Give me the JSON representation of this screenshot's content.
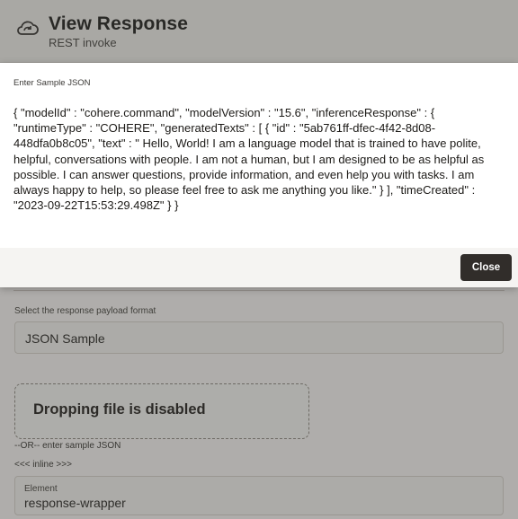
{
  "header": {
    "title": "View Response",
    "subtitle": "REST invoke",
    "icon": "cloud-refresh-icon"
  },
  "dialog": {
    "label": "Enter Sample JSON",
    "json_text": "{ \"modelId\" : \"cohere.command\", \"modelVersion\" : \"15.6\", \"inferenceResponse\" : { \"runtimeType\" : \"COHERE\", \"generatedTexts\" : [ { \"id\" : \"5ab761ff-dfec-4f42-8d08-448dfa0b8c05\", \"text\" : \" Hello, World! I am a language model that is trained to have polite, helpful, conversations with people. I am not a human, but I am designed to be as helpful as possible. I can answer questions, provide information, and even help you with tasks. I am always happy to help, so please feel free to ask me anything you like.\" } ], \"timeCreated\" : \"2023-09-22T15:53:29.498Z\" } }",
    "close_label": "Close"
  },
  "form": {
    "payload_format_label": "Select the response payload format",
    "payload_format_value": "JSON Sample",
    "drop_zone_text": "Dropping file is disabled",
    "or_text": "--OR-- enter sample JSON",
    "inline_text": "<<< inline >>>",
    "element_label": "Element",
    "element_value": "response-wrapper"
  },
  "colors": {
    "overlay": "#46444099",
    "button_bg": "#312d2a",
    "dialog_bg": "#ffffff"
  }
}
